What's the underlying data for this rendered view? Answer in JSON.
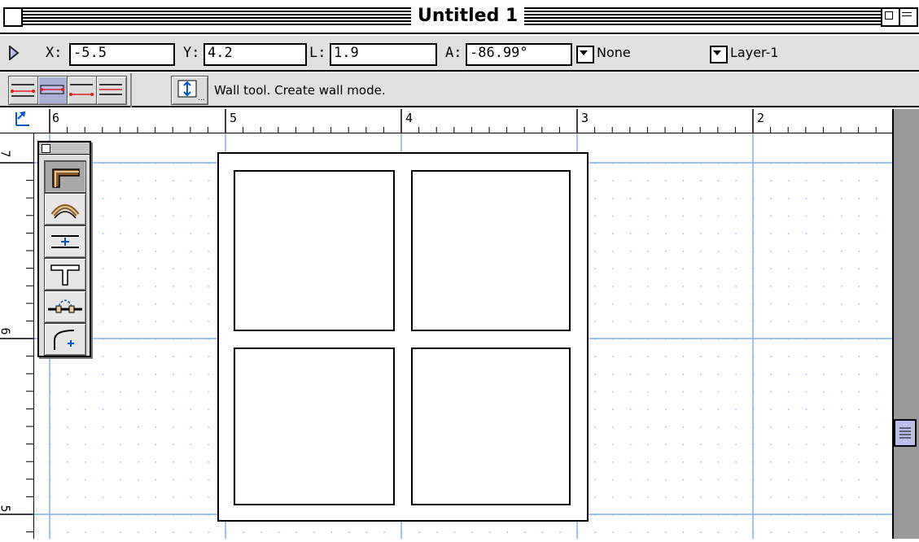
{
  "window": {
    "title": "Untitled 1"
  },
  "coords": {
    "x_label": "X:",
    "x_value": "-5.5",
    "y_label": "Y:",
    "y_value": "4.2",
    "l_label": "L:",
    "l_value": "1.9",
    "a_label": "A:",
    "a_value": "-86.99°",
    "class_dropdown": "None",
    "layer_dropdown": "Layer-1"
  },
  "modebar": {
    "hint": "Wall tool. Create wall mode.",
    "modes": [
      "wall-left-edge",
      "wall-center",
      "wall-right-edge",
      "wall-custom-offset"
    ],
    "active_mode": "wall-center"
  },
  "rulers": {
    "horizontal": [
      "6",
      "5",
      "4",
      "3",
      "2"
    ],
    "vertical": [
      "7",
      "6",
      "5"
    ]
  },
  "palette": {
    "tools": [
      "wall-icon",
      "round-wall-icon",
      "insert-in-wall-icon",
      "wall-join-icon",
      "wall-arc-icon",
      "fillet-icon"
    ],
    "selected": "wall-icon"
  },
  "colors": {
    "grid_major": "#7fb0f0",
    "grid_minor_dot": "#7fb0f0",
    "active_mode": "#a8b0d8",
    "scroll_thumb": "#b9bfe8",
    "chrome_gray": "#e0e0e0"
  }
}
